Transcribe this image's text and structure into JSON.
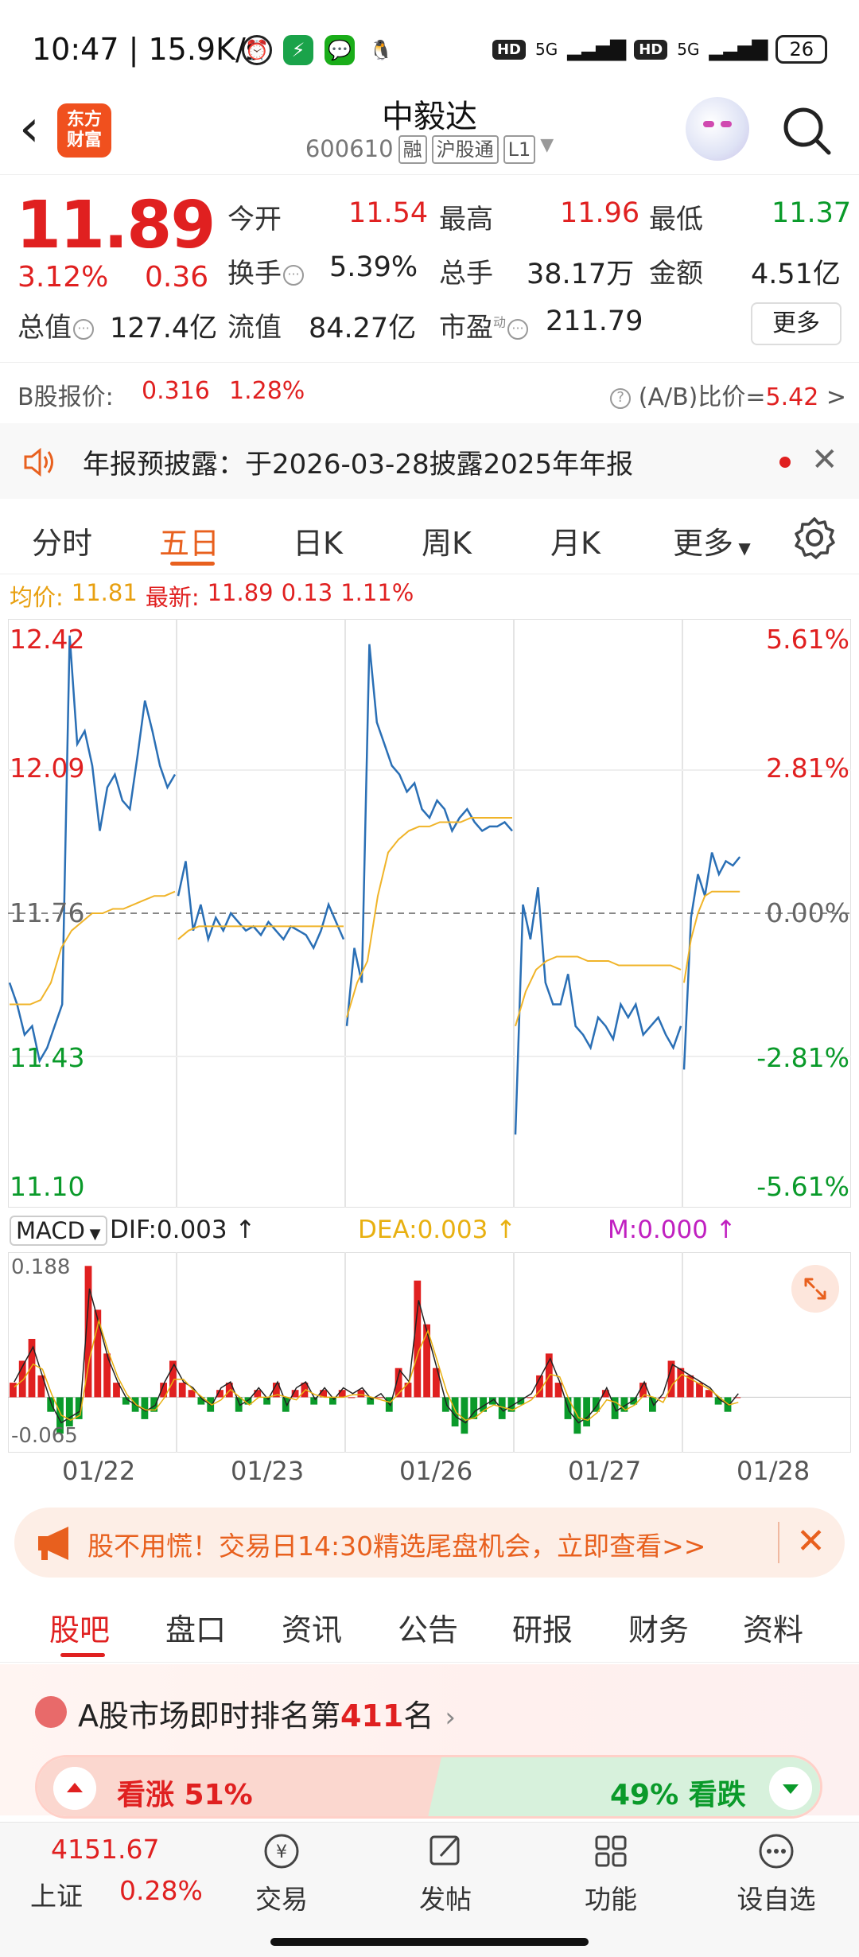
{
  "status_bar": {
    "time": "10:47",
    "speed": "15.9K/s",
    "network1": "5G",
    "network2": "5G",
    "battery": "26"
  },
  "header": {
    "logo_line1": "东方",
    "logo_line2": "财富",
    "stock_name": "中毅达",
    "stock_code": "600610",
    "tags": [
      "融",
      "沪股通",
      "L1"
    ]
  },
  "quote": {
    "price": "11.89",
    "change_pct": "3.12%",
    "change": "0.36",
    "open_label": "今开",
    "open": "11.54",
    "high_label": "最高",
    "high": "11.96",
    "low_label": "最低",
    "low": "11.37",
    "turnover_label": "换手",
    "turnover": "5.39%",
    "volume_label": "总手",
    "volume": "38.17万",
    "amount_label": "金额",
    "amount": "4.51亿",
    "mcap_label": "总值",
    "mcap": "127.4亿",
    "float_label": "流值",
    "float": "84.27亿",
    "pe_label": "市盈",
    "pe_sup": "动",
    "pe": "211.79",
    "more_label": "更多"
  },
  "bshare": {
    "label": "B股报价:",
    "price": "0.316",
    "pct": "1.28%",
    "ratio_label": "(A/B)比价=",
    "ratio": "5.42"
  },
  "notice": {
    "text": "年报预披露：于2026-03-28披露2025年年报"
  },
  "chart_tabs": [
    "分时",
    "五日",
    "日K",
    "周K",
    "月K",
    "更多"
  ],
  "chart_tab_active": 1,
  "legend": {
    "avg_label": "均价:",
    "avg": "11.81",
    "latest_label": "最新:",
    "latest": "11.89",
    "change": "0.13",
    "pct": "1.11%"
  },
  "colors": {
    "up": "#e02020",
    "down": "#0a9a2a",
    "price_line": "#2a6fb5",
    "avg_line": "#f0b429",
    "accent": "#e8601e"
  },
  "chart_data": {
    "type": "line",
    "x": [
      "01/22",
      "01/23",
      "01/26",
      "01/27",
      "01/28"
    ],
    "ylim": [
      11.1,
      12.42
    ],
    "y_ticks_left": [
      "12.42",
      "12.09",
      "11.76",
      "11.43",
      "11.10"
    ],
    "y_ticks_right": [
      "5.61%",
      "2.81%",
      "0.00%",
      "-2.81%",
      "-5.61%"
    ],
    "reference": 11.76,
    "series": [
      {
        "values": [
          [
            11.6,
            11.55,
            11.48,
            11.5,
            11.42,
            11.45,
            11.5,
            11.55,
            12.4,
            12.15,
            12.18,
            12.1,
            11.95,
            12.05,
            12.08,
            12.02,
            12.0,
            12.12,
            12.25,
            12.18,
            12.1,
            12.05,
            12.08
          ],
          [
            11.8,
            11.88,
            11.72,
            11.78,
            11.7,
            11.75,
            11.72,
            11.76,
            11.74,
            11.72,
            11.73,
            11.71,
            11.74,
            11.72,
            11.7,
            11.73,
            11.72,
            11.71,
            11.68,
            11.72,
            11.78,
            11.74,
            11.7
          ],
          [
            11.5,
            11.68,
            11.6,
            12.38,
            12.2,
            12.15,
            12.1,
            12.08,
            12.04,
            12.06,
            12.0,
            11.98,
            12.02,
            12.0,
            11.95,
            11.98,
            12.0,
            11.97,
            11.95,
            11.96,
            11.96,
            11.97,
            11.95
          ],
          [
            11.25,
            11.78,
            11.7,
            11.82,
            11.6,
            11.55,
            11.55,
            11.62,
            11.5,
            11.48,
            11.45,
            11.52,
            11.5,
            11.47,
            11.55,
            11.52,
            11.55,
            11.48,
            11.5,
            11.52,
            11.48,
            11.45,
            11.5
          ],
          [
            11.4,
            11.75,
            11.85,
            11.8,
            11.9,
            11.85,
            11.88,
            11.87,
            11.89
          ]
        ]
      },
      {
        "values": [
          [
            11.55,
            11.55,
            11.55,
            11.56,
            11.6,
            11.68,
            11.72,
            11.74,
            11.76,
            11.76,
            11.77,
            11.77,
            11.78,
            11.79,
            11.8,
            11.8,
            11.81
          ],
          [
            11.7,
            11.72,
            11.73,
            11.73,
            11.73,
            11.73,
            11.73,
            11.73,
            11.73,
            11.73,
            11.73,
            11.73,
            11.73,
            11.73,
            11.73,
            11.73,
            11.73
          ],
          [
            11.52,
            11.6,
            11.65,
            11.8,
            11.9,
            11.93,
            11.95,
            11.96,
            11.96,
            11.97,
            11.97,
            11.97,
            11.98,
            11.98,
            11.98,
            11.98,
            11.98
          ],
          [
            11.5,
            11.58,
            11.63,
            11.65,
            11.66,
            11.66,
            11.66,
            11.65,
            11.65,
            11.65,
            11.64,
            11.64,
            11.64,
            11.64,
            11.64,
            11.64,
            11.63
          ],
          [
            11.6,
            11.7,
            11.76,
            11.8,
            11.81,
            11.81,
            11.81,
            11.81,
            11.81
          ]
        ]
      }
    ]
  },
  "macd": {
    "selector": "MACD",
    "dif": "DIF:0.003",
    "dea": "DEA:0.003",
    "m": "M:0.000",
    "max": "0.188",
    "min": "-0.065",
    "histogram": [
      0.02,
      0.05,
      0.08,
      0.03,
      -0.02,
      -0.05,
      -0.04,
      -0.03,
      0.18,
      0.12,
      0.06,
      0.02,
      -0.01,
      -0.02,
      -0.03,
      -0.02,
      0.02,
      0.05,
      0.02,
      0.01,
      -0.01,
      -0.02,
      0.01,
      0.02,
      -0.02,
      -0.01,
      0.01,
      -0.01,
      0.02,
      -0.02,
      0.01,
      0.02,
      -0.01,
      0.01,
      -0.01,
      0.01,
      0.0,
      0.01,
      -0.01,
      0.0,
      -0.02,
      0.04,
      0.02,
      0.16,
      0.1,
      0.04,
      -0.02,
      -0.04,
      -0.05,
      -0.03,
      -0.02,
      -0.01,
      -0.03,
      -0.02,
      -0.01,
      0.0,
      0.03,
      0.06,
      0.02,
      -0.03,
      -0.05,
      -0.04,
      -0.02,
      0.01,
      -0.03,
      -0.02,
      -0.01,
      0.02,
      -0.02,
      0.0,
      0.05,
      0.04,
      0.03,
      0.02,
      0.01,
      -0.01,
      -0.02,
      0.0
    ]
  },
  "dates": [
    "01/22",
    "01/23",
    "01/26",
    "01/27",
    "01/28"
  ],
  "promo": {
    "text": "股不用慌！交易日14:30精选尾盘机会，立即查看>>"
  },
  "bottom_tabs": [
    "股吧",
    "盘口",
    "资讯",
    "公告",
    "研报",
    "财务",
    "资料"
  ],
  "bottom_tab_active": 0,
  "ranking": {
    "prefix": "A股市场即时排名第",
    "num": "411",
    "suffix": "名",
    "up_label": "看涨 51%",
    "down_label": "49% 看跌"
  },
  "bottom_nav": {
    "index_value": "4151.67",
    "index_name": "上证",
    "index_pct": "0.28%",
    "items": [
      "交易",
      "发帖",
      "功能",
      "设自选"
    ]
  }
}
